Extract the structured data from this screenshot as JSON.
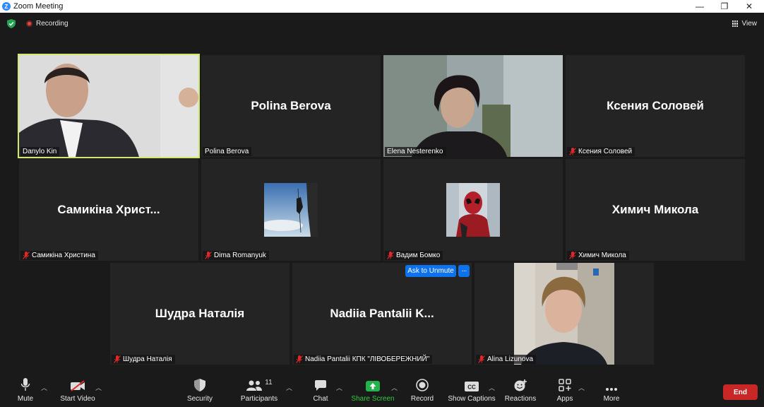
{
  "window": {
    "title": "Zoom Meeting",
    "minimize": "—",
    "restore": "❐",
    "close": "✕"
  },
  "topbar": {
    "recording_label": "Recording",
    "view_label": "View"
  },
  "participants": [
    {
      "display": "",
      "label": "Danylo Kin",
      "muted": false,
      "has_video": true
    },
    {
      "display": "Polina Berova",
      "label": "Polina Berova",
      "muted": false,
      "has_video": false
    },
    {
      "display": "",
      "label": "Elena Nesterenko",
      "muted": false,
      "has_video": true
    },
    {
      "display": "Ксения Соловей",
      "label": "Ксения Соловей",
      "muted": true,
      "has_video": false
    },
    {
      "display": "Самикіна Христ...",
      "label": "Самикіна Христина",
      "muted": true,
      "has_video": false
    },
    {
      "display": "",
      "label": "Dima Romanyuk",
      "muted": true,
      "has_video": false
    },
    {
      "display": "",
      "label": "Вадим Бомко",
      "muted": true,
      "has_video": false
    },
    {
      "display": "Химич Микола",
      "label": "Химич Микола",
      "muted": true,
      "has_video": false
    },
    {
      "display": "Шудра Наталія",
      "label": "Шудра Наталія",
      "muted": true,
      "has_video": false
    },
    {
      "display": "Nadiia Pantalii K...",
      "label": "Nadiia Pantalii КПК \"ЛІВОБЕРЕЖНИЙ\"",
      "muted": true,
      "has_video": false
    },
    {
      "display": "",
      "label": "Alina Lizunova",
      "muted": true,
      "has_video": true
    }
  ],
  "hover_actions": {
    "ask_to_unmute": "Ask to Unmute",
    "more": "···"
  },
  "toolbar": {
    "mute": "Mute",
    "start_video": "Start Video",
    "security": "Security",
    "participants": "Participants",
    "participants_count": "11",
    "chat": "Chat",
    "share_screen": "Share Screen",
    "record": "Record",
    "show_captions": "Show Captions",
    "reactions": "Reactions",
    "apps": "Apps",
    "more": "More",
    "end": "End"
  },
  "colors": {
    "accent_blue": "#0e72ed",
    "active_speaker": "#cfe86e",
    "share_green": "#2ecc40",
    "end_red": "#c92626"
  }
}
